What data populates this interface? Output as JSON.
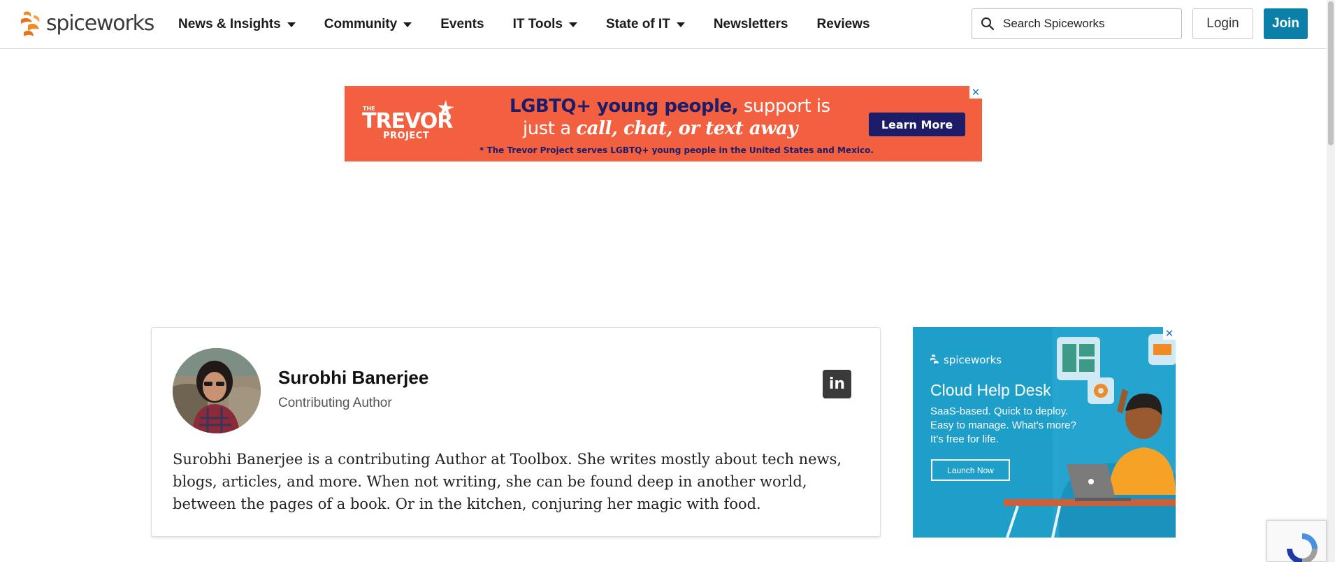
{
  "header": {
    "logo_text": "spiceworks",
    "nav": [
      {
        "label": "News & Insights",
        "dropdown": true
      },
      {
        "label": "Community",
        "dropdown": true
      },
      {
        "label": "Events",
        "dropdown": false
      },
      {
        "label": "IT Tools",
        "dropdown": true
      },
      {
        "label": "State of IT",
        "dropdown": true
      },
      {
        "label": "Newsletters",
        "dropdown": false
      },
      {
        "label": "Reviews",
        "dropdown": false
      }
    ],
    "search_placeholder": "Search Spiceworks",
    "login_label": "Login",
    "join_label": "Join"
  },
  "top_ad": {
    "brand_the": "THE",
    "brand_name": "TREVOR",
    "brand_project": "PROJECT",
    "headline_highlight": "LGBTQ+ young people,",
    "headline_rest": "support is",
    "line2_prefix": "just a",
    "line2_emphasis": "call, chat, or text away",
    "footnote": "* The Trevor Project serves LGBTQ+ young people in the United States and Mexico.",
    "cta_label": "Learn More",
    "close_glyph": "✕"
  },
  "author": {
    "name": "Surobhi Banerjee",
    "role": "Contributing Author",
    "linkedin_glyph": "in",
    "bio": "Surobhi Banerjee is a contributing Author at Toolbox. She writes mostly about tech news, blogs, articles, and more. When not writing, she can be found deep in another world, between the pages of a book. Or in the kitchen, conjuring her magic with food."
  },
  "side_ad": {
    "brand": "spiceworks",
    "title": "Cloud Help Desk",
    "description": "SaaS-based. Quick to deploy. Easy to manage. What's more? It's free for life.",
    "cta_label": "Launch Now",
    "close_glyph": "✕"
  },
  "colors": {
    "brand_blue": "#0a7fa8",
    "trevor_orange": "#f2603f",
    "trevor_navy": "#1c1c68",
    "side_ad_blue": "#1d9fc9",
    "logo_orange": "#f08a24"
  }
}
